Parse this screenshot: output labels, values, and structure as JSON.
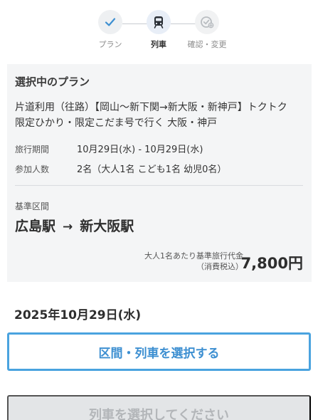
{
  "stepper": {
    "steps": [
      {
        "label": "プラン",
        "icon": "check-icon",
        "state": "done"
      },
      {
        "label": "列車",
        "icon": "train-icon",
        "state": "current"
      },
      {
        "label": "確認・変更",
        "icon": "check-circle-icon",
        "state": "todo"
      }
    ]
  },
  "plan": {
    "title": "選択中のプラン",
    "name": "片道利用（往路）【岡山〜新下関→新大阪・新神戸】トクトク　限定ひかり・限定こだま号で行く 大阪・神戸",
    "period_label": "旅行期間",
    "period_value": "10月29日(水) - 10月29日(水)",
    "participants_label": "参加人数",
    "participants_value": "2名（大人1名 こども1名 幼児0名）",
    "base_section_label": "基準区間",
    "from": "広島駅",
    "arrow": "→",
    "to": "新大阪駅",
    "price_note_line1": "大人1名あたり基準旅行代金",
    "price_note_line2": "（消費税込）",
    "price": "7,800円"
  },
  "date": "2025年10月29日(水)",
  "buttons": {
    "select": "区間・列車を選択する",
    "disabled": "列車を選択してください"
  },
  "colors": {
    "accent": "#3d8fd1",
    "border_accent": "#4aa3df",
    "card_bg": "#f4f5f6",
    "disabled_bg": "#e3e5e7"
  }
}
